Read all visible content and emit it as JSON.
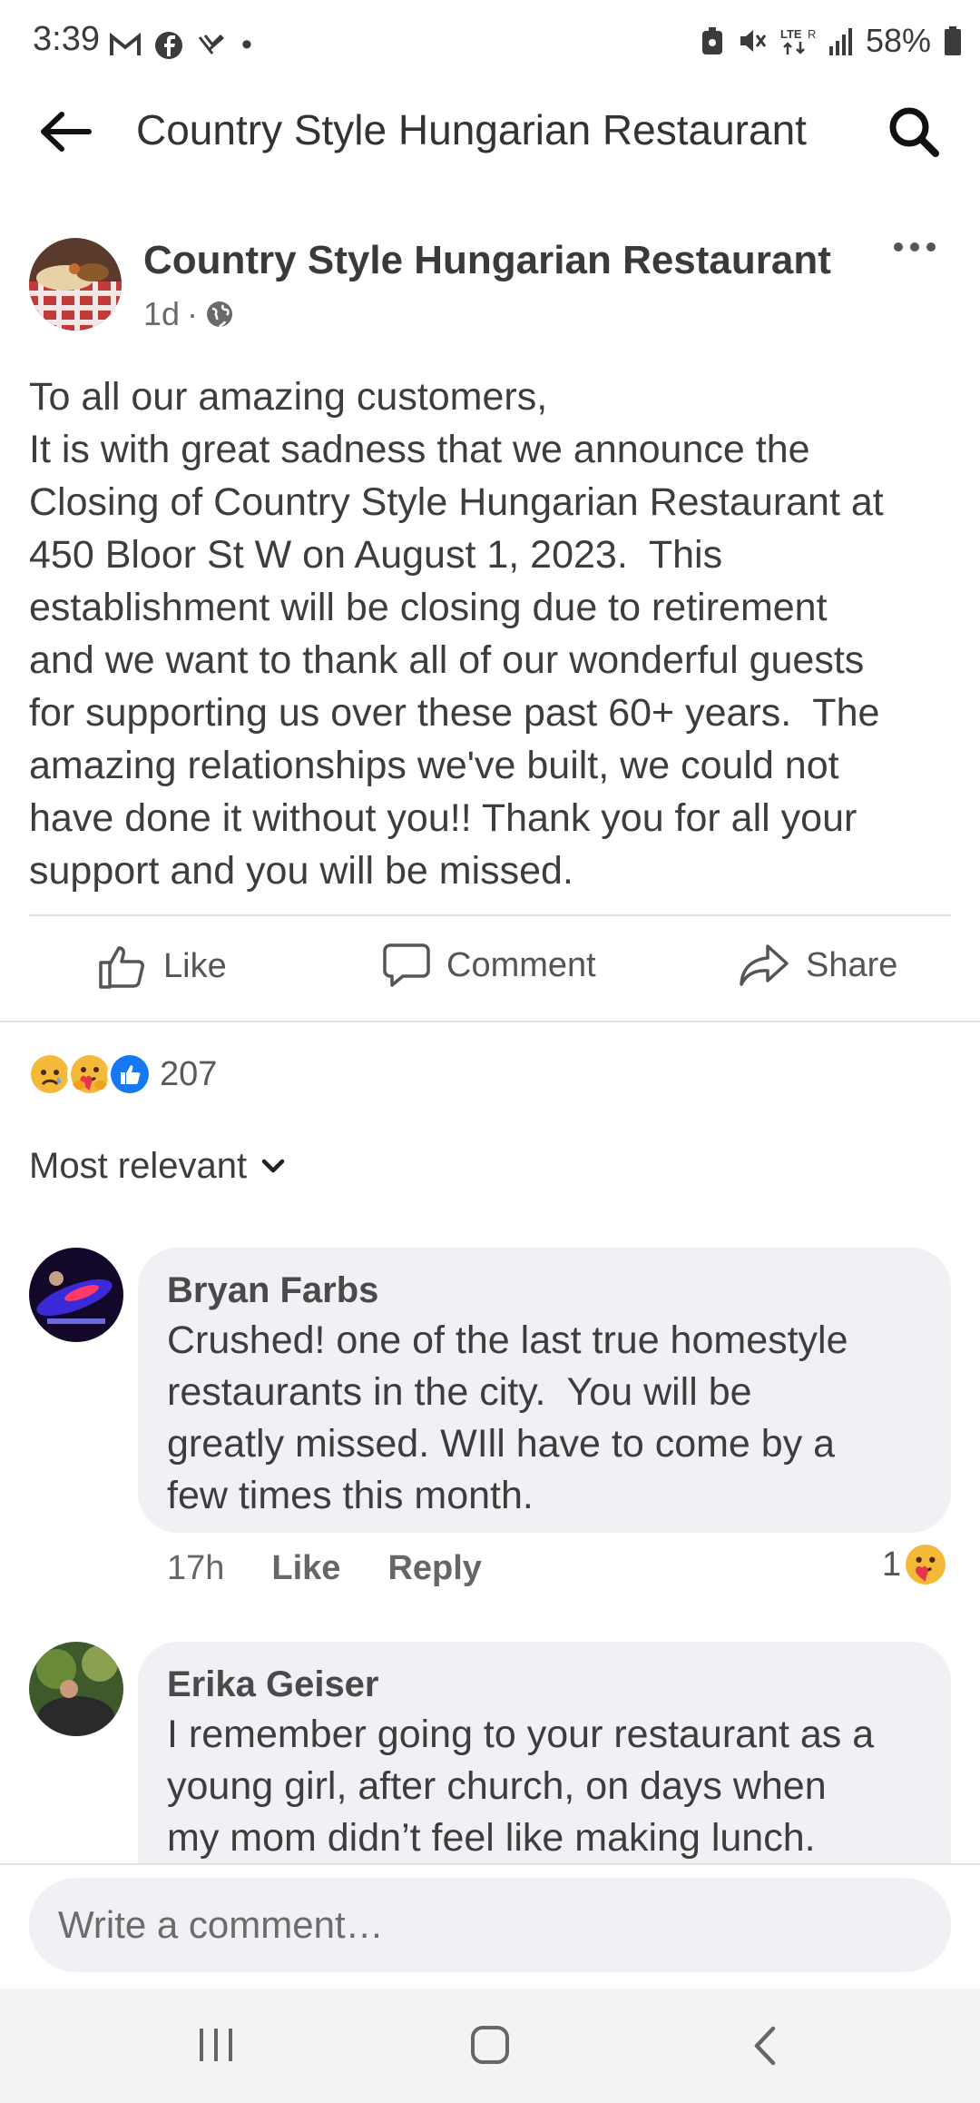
{
  "status_bar": {
    "time": "3:39",
    "dot": "•",
    "battery": "58%",
    "icons": [
      "gmail-icon",
      "facebook-icon",
      "wifi-calling-icon",
      "lock-icon",
      "mute-icon",
      "lte-signal-icon",
      "signal-bars-icon",
      "battery-icon"
    ]
  },
  "header": {
    "title": "Country Style Hungarian Restaurant",
    "back_icon": "back-arrow-icon",
    "search_icon": "search-icon"
  },
  "post": {
    "page_name": "Country Style Hungarian Restaurant",
    "time": "1d",
    "separator": "·",
    "privacy_icon": "globe-icon",
    "text_lines": [
      "To all our amazing customers,",
      "It is with great sadness that we announce the",
      "Closing of Country Style Hungarian Restaurant at",
      "450 Bloor St W on August 1, 2023.  This",
      "establishment will be closing due to retirement",
      "and we want to thank all of our wonderful guests",
      "for supporting us over these past 60+ years.  The",
      "amazing relationships we've built, we could not",
      "have done it without you!! Thank you for all your",
      "support and you will be missed."
    ]
  },
  "actions": {
    "like": "Like",
    "comment": "Comment",
    "share": "Share"
  },
  "reactions": {
    "count": "207",
    "types": [
      "sad",
      "care",
      "like"
    ]
  },
  "sort": {
    "label": "Most relevant"
  },
  "comments": [
    {
      "name": "Bryan Farbs",
      "lines": [
        "Crushed! one of the last true homestyle",
        "restaurants in the city.  You will be",
        "greatly missed. WIll have to come by a",
        "few times this month."
      ],
      "time": "17h",
      "like": "Like",
      "reply": "Reply",
      "reaction_count": "1"
    },
    {
      "name": "Erika Geiser",
      "lines": [
        "I remember going to your restaurant as a",
        "young girl, after church, on days when",
        "my mom didn’t feel like making lunch."
      ]
    }
  ],
  "composer": {
    "placeholder": "Write a comment…"
  },
  "colors": {
    "like_blue": "#1877f2",
    "bubble_bg": "#f0f1f5",
    "text": "#3d3d3d"
  }
}
